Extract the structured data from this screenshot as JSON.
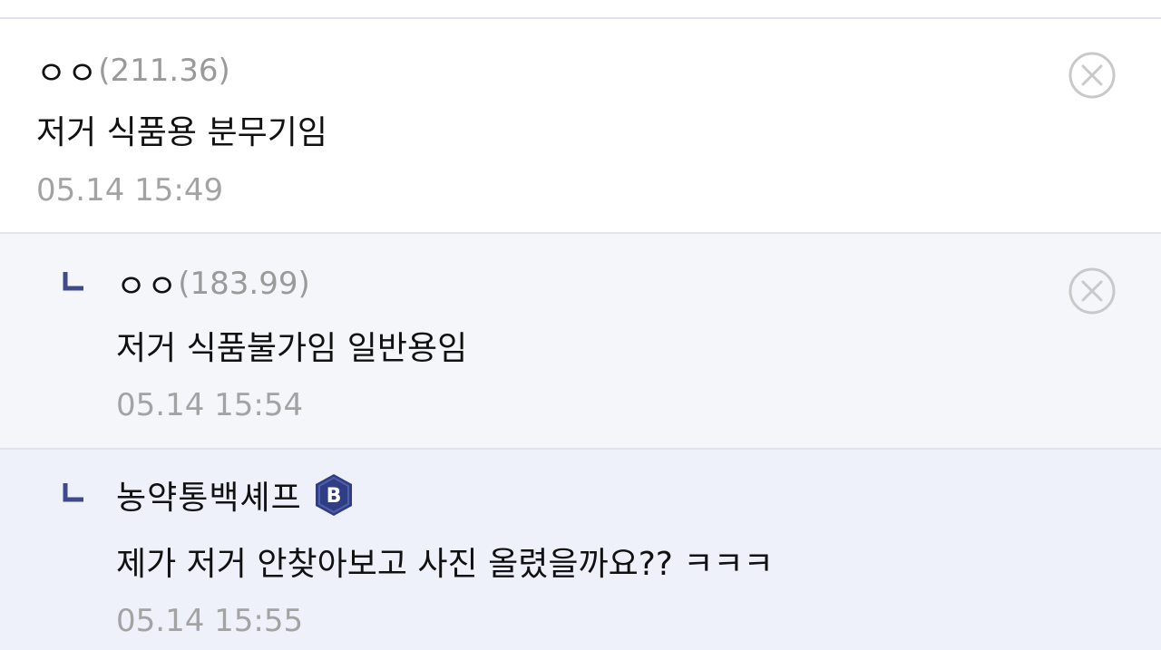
{
  "comments": [
    {
      "nickname": "ㅇㅇ",
      "ip": "(211.36)",
      "text": "저거 식품용 분무기임",
      "time": "05.14 15:49",
      "is_reply": false
    },
    {
      "nickname": "ㅇㅇ",
      "ip": "(183.99)",
      "text": "저거 식품불가임 일반용임",
      "time": "05.14 15:54",
      "is_reply": true
    },
    {
      "nickname": "농약통백셰프",
      "badge_letter": "B",
      "text": "제가 저거 안찾아보고 사진 올렸을까요?? ㅋㅋㅋ",
      "time": "05.14 15:55",
      "is_reply": true
    }
  ],
  "colors": {
    "reply_mark": "#3f4a8a",
    "badge_bg": "#2f3e84",
    "delete_icon": "#c9c9c9",
    "reply_bg": "#f5f6f9",
    "author_reply_bg": "#eef1f9"
  },
  "icons": {
    "delete": "circle-x-icon",
    "reply": "reply-corner-icon",
    "badge": "hexagon-badge-icon"
  }
}
